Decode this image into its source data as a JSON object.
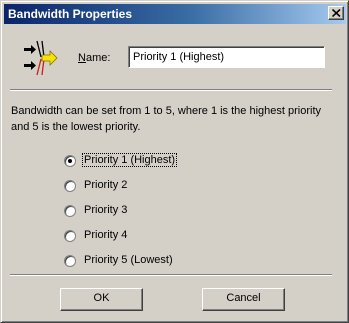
{
  "window": {
    "title": "Bandwidth Properties"
  },
  "icons": {
    "app": "bandwidth-priority-icon",
    "close": "close-icon"
  },
  "name_field": {
    "label_accel": "N",
    "label_rest": "ame:",
    "value": "Priority 1 (Highest)"
  },
  "description": "Bandwidth can be set from 1 to 5, where 1 is the highest priority and 5 is the lowest priority.",
  "priority_options": [
    {
      "label": "Priority 1 (Highest)",
      "selected": true
    },
    {
      "label": "Priority 2",
      "selected": false
    },
    {
      "label": "Priority 3",
      "selected": false
    },
    {
      "label": "Priority 4",
      "selected": false
    },
    {
      "label": "Priority 5 (Lowest)",
      "selected": false
    }
  ],
  "buttons": {
    "ok": "OK",
    "cancel": "Cancel"
  },
  "colors": {
    "title_gradient_start": "#0a246a",
    "title_gradient_end": "#a6caf0",
    "face": "#d4d0c8",
    "icon_arrow_yellow": "#f5e400"
  }
}
